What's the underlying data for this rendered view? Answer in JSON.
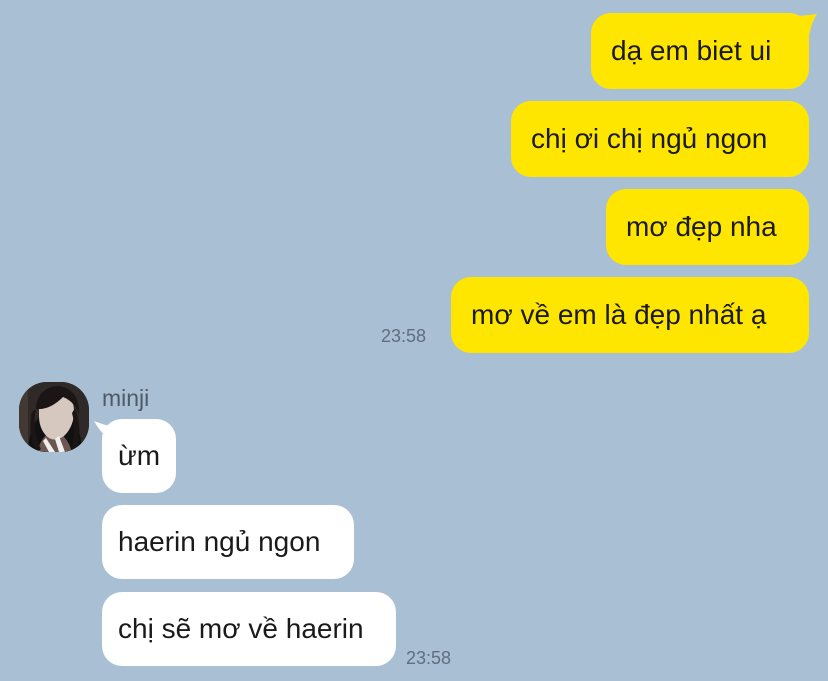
{
  "chat": {
    "outgoing": [
      {
        "text": "dạ em biet ui"
      },
      {
        "text": "chị ơi chị ngủ ngon"
      },
      {
        "text": "mơ đẹp nha"
      },
      {
        "text": "mơ về em là đẹp nhất ạ"
      }
    ],
    "outgoing_time": "23:58",
    "incoming_sender": "minji",
    "incoming": [
      {
        "text": "ừm"
      },
      {
        "text": "haerin ngủ ngon"
      },
      {
        "text": "chị sẽ mơ về haerin"
      }
    ],
    "incoming_time": "23:58"
  },
  "colors": {
    "background": "#a9bfd3",
    "outgoing_bubble": "#ffe600",
    "incoming_bubble": "#ffffff",
    "timestamp": "#5f6f80"
  },
  "icons": {
    "avatar": "profile-photo"
  }
}
